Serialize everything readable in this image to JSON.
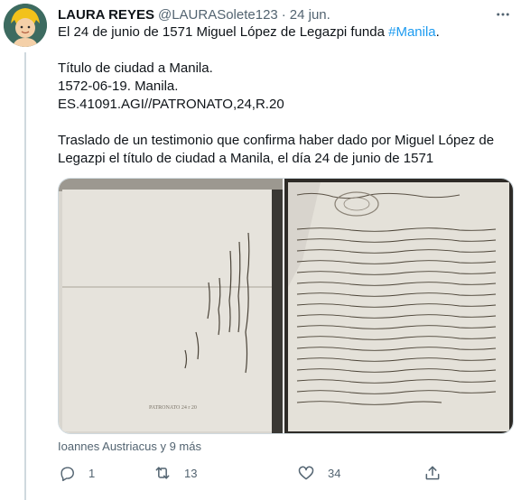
{
  "tweet": {
    "display_name": "LAURA REYES",
    "handle": "@LAURASolete123",
    "separator": "·",
    "date": "24 jun.",
    "body": {
      "line1_text": "El 24 de junio de 1571 Miguel López de Legazpi funda ",
      "line1_hashtag": "#Manila",
      "line1_end": ".",
      "title": "Título de ciudad a Manila.",
      "date_place": "1572-06-19. Manila.",
      "reference": "ES.41091.AGI//PATRONATO,24,R.20",
      "desc_line1": "Traslado de un testimonio que confirma haber dado por Miguel López de",
      "desc_line2": "Legazpi el título de ciudad a Manila, el día 24 de junio de 1571"
    },
    "tagged_users": "Ioannes Austriacus y 9 más",
    "stats": {
      "replies": "1",
      "retweets": "13",
      "likes": "34"
    }
  },
  "icons": [
    "avatar",
    "more-icon",
    "reply-icon",
    "retweet-icon",
    "like-icon",
    "share-icon"
  ],
  "colors": {
    "accent": "#1d9bf0",
    "secondary_text": "#536471",
    "border": "#cfd9de",
    "paper": "#e4e1da",
    "ink": "#4a4338"
  }
}
